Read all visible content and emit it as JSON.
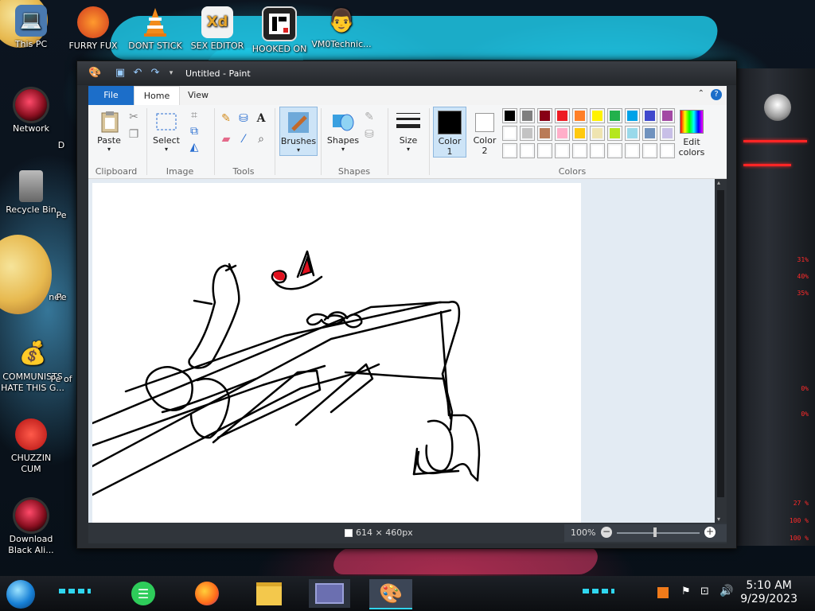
{
  "desktop": {
    "icons": [
      {
        "label": "This PC",
        "glyph": "💻"
      },
      {
        "label": "FURRY FUX",
        "glyph": "🦊"
      },
      {
        "label": "DONT STICK",
        "glyph": "🔶"
      },
      {
        "label": "SEX EDITOR",
        "glyph": "Xd"
      },
      {
        "label": "HOOKED ON",
        "glyph": "▮"
      },
      {
        "label": "VM0Technic...",
        "glyph": "👨"
      },
      {
        "label": "Network",
        "glyph": ""
      },
      {
        "label": "Recycle Bin",
        "glyph": "🗑"
      },
      {
        "label": "nel",
        "glyph": ""
      },
      {
        "label": "COMMUNISTS HATE THIS G...",
        "glyph": "💰"
      },
      {
        "label": "CHUZZIN CUM",
        "glyph": "🔴"
      },
      {
        "label": "Download Black Ali...",
        "glyph": ""
      }
    ],
    "partial_labels": [
      "D",
      "Pe",
      "Pe",
      "Pe of"
    ]
  },
  "side_panel": {
    "readouts": [
      "31%",
      "40%",
      "35%",
      "0%",
      "0%",
      "27 %",
      "100 %",
      "100 %"
    ]
  },
  "paint": {
    "title": "Untitled - Paint",
    "tabs": [
      "File",
      "Home",
      "View"
    ],
    "ribbon": {
      "clipboard": {
        "paste": "Paste",
        "group": "Clipboard"
      },
      "image": {
        "select": "Select",
        "group": "Image"
      },
      "tools": {
        "group": "Tools"
      },
      "brushes": {
        "label": "Brushes"
      },
      "shapes": {
        "label": "Shapes",
        "group": "Shapes"
      },
      "size": {
        "label": "Size"
      },
      "color1": {
        "line1": "Color",
        "line2": "1"
      },
      "color2": {
        "line1": "Color",
        "line2": "2"
      },
      "colors": {
        "group": "Colors",
        "edit_line1": "Edit",
        "edit_line2": "colors"
      }
    },
    "palette": [
      "#000000",
      "#7f7f7f",
      "#880015",
      "#ed1c24",
      "#ff7f27",
      "#fff200",
      "#22b14c",
      "#00a2e8",
      "#3f48cc",
      "#a349a4",
      "#ffffff",
      "#c3c3c3",
      "#b97a57",
      "#ffaec9",
      "#ffc90e",
      "#efe4b0",
      "#b5e61d",
      "#99d9ea",
      "#7092be",
      "#c8bfe7",
      "",
      "",
      "",
      "",
      "",
      "",
      "",
      "",
      "",
      ""
    ],
    "status": {
      "dimensions": "614 × 460px",
      "zoom": "100%"
    }
  },
  "taskbar": {
    "time": "5:10 AM",
    "date": "9/29/2023"
  }
}
